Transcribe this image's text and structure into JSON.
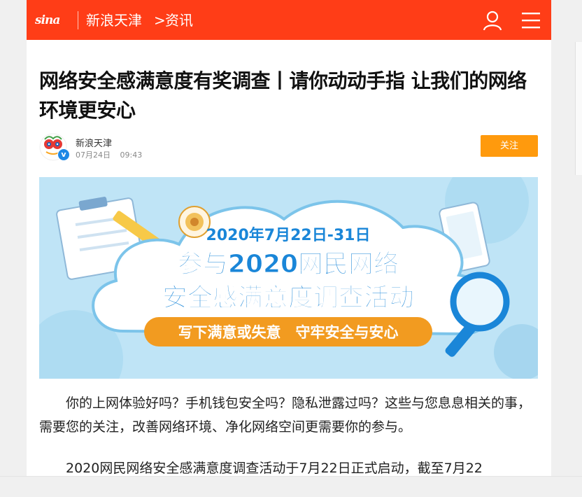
{
  "header": {
    "logo_text": "sina",
    "channel": "新浪天津",
    "chevron": ">",
    "section": "资讯"
  },
  "article": {
    "title": "网络安全感满意度有奖调查丨请你动动手指 让我们的网络环境更安心",
    "author": "新浪天津",
    "date": "07月24日",
    "time": "09:43",
    "follow_label": "关注",
    "verified_mark": "v",
    "paragraphs": [
      "你的上网体验好吗？手机钱包安全吗？隐私泄露过吗？这些与您息息相关的事，需要您的关注，改善网络环境、净化网络空间更需要你的参与。",
      "2020网民网络安全感满意度调查活动于7月22日正式启动，截至7月22"
    ]
  },
  "banner": {
    "date_line": "2020年7月22日-31日",
    "headline_1": "参与2020网民网络",
    "headline_2": "安全感满意度调查活动",
    "slogan": "写下满意或失意　守牢安全与安心"
  },
  "colors": {
    "brand": "#ff3d17",
    "follow": "#ff9a0d",
    "banner_bg": "#bfe4f6",
    "banner_text": "#1a86d8"
  }
}
